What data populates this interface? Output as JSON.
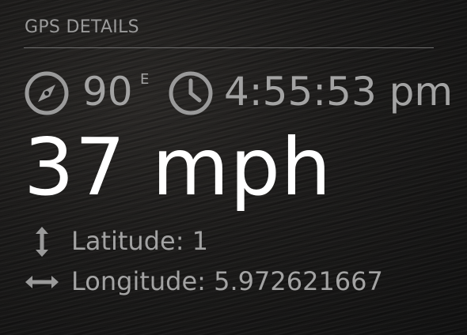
{
  "header": {
    "title": "GPS DETAILS"
  },
  "heading": {
    "icon": "compass-icon",
    "value": "90",
    "direction": "E"
  },
  "clock": {
    "icon": "clock-icon",
    "time": "4:55:53 pm"
  },
  "speed": {
    "text": "37 mph"
  },
  "latitude": {
    "icon": "vertical-arrows-icon",
    "label": "Latitude: 1"
  },
  "longitude": {
    "icon": "horizontal-arrows-icon",
    "label": "Longitude: 5.972621667"
  },
  "colors": {
    "text_muted": "#a3a3a3",
    "text_primary": "#ffffff",
    "divider": "#6e6e6e"
  }
}
